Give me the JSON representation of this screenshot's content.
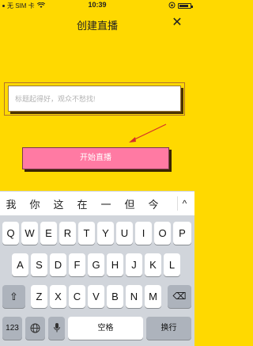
{
  "status": {
    "carrier": "无 SIM 卡",
    "time": "10:39",
    "battery_level": 0.85
  },
  "nav": {
    "title": "创建直播",
    "close_symbol": "✕"
  },
  "title_input": {
    "placeholder": "标题起得好，观众不愁找!",
    "value": ""
  },
  "start_button": {
    "label": "开始直播"
  },
  "suggestions": [
    "我",
    "你",
    "这",
    "在",
    "一",
    "但",
    "今"
  ],
  "suggestion_toggle": "^",
  "keyboard": {
    "row1": [
      "Q",
      "W",
      "E",
      "R",
      "T",
      "Y",
      "U",
      "I",
      "O",
      "P"
    ],
    "row2": [
      "A",
      "S",
      "D",
      "F",
      "G",
      "H",
      "J",
      "K",
      "L"
    ],
    "row3": [
      "Z",
      "X",
      "C",
      "V",
      "B",
      "N",
      "M"
    ],
    "shift_icon": "⇧",
    "delete_icon": "⌫",
    "numbers_label": "123",
    "globe_icon": "🌐",
    "mic_icon": "🎤",
    "space_label": "空格",
    "return_label": "换行"
  }
}
